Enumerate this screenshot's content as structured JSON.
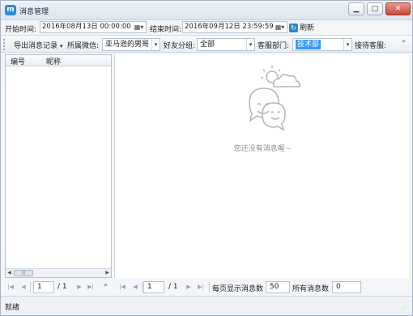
{
  "window": {
    "title": "消息管理",
    "app_icon": "m",
    "min_icon": "minimize-icon",
    "max_icon": "maximize-icon",
    "close_icon": "close-icon"
  },
  "filters": {
    "start_label": "开始时间:",
    "start_value": "2016年08月13日  00:00:00",
    "end_label": "结束时间:",
    "end_value": "2016年09月12日  23:59:59",
    "refresh_label": "刷新"
  },
  "toolbar": {
    "export_label": "导出消息记录",
    "wechat_label": "所属微信:",
    "wechat_value": "亚马逊的男哥",
    "group_label": "好友分组:",
    "group_value": "全部",
    "dept_label": "客服部门:",
    "dept_value": "技术部",
    "agent_label": "接待客服:",
    "more": "»"
  },
  "left_panel": {
    "columns": [
      "编号",
      "昵称"
    ]
  },
  "main": {
    "empty_text": "您还没有消息喔~"
  },
  "left_pager": {
    "page": "1",
    "total": "/ 1",
    "more": "»"
  },
  "main_pager": {
    "page": "1",
    "total": "/ 1",
    "per_page_label": "每页显示消息数",
    "per_page_value": "50",
    "all_label": "所有消息数",
    "all_value": "0"
  },
  "status": {
    "text": "就绪"
  }
}
